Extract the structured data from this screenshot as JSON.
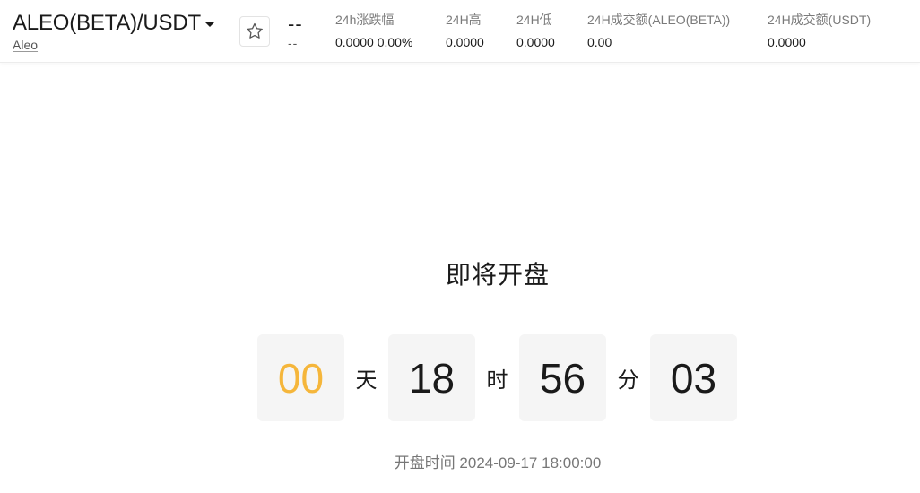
{
  "header": {
    "pair_name": "ALEO(BETA)/USDT",
    "pair_subname": "Aleo",
    "favorite_icon": "star-icon",
    "price": "--",
    "price_change": "--",
    "stats": [
      {
        "label": "24h涨跌幅",
        "value": "0.0000 0.00%"
      },
      {
        "label": "24H高",
        "value": "0.0000"
      },
      {
        "label": "24H低",
        "value": "0.0000"
      },
      {
        "label": "24H成交额(ALEO(BETA))",
        "value": "0.00"
      },
      {
        "label": "24H成交额(USDT)",
        "value": "0.0000"
      }
    ]
  },
  "main": {
    "headline": "即将开盘",
    "countdown": {
      "days": "00",
      "days_unit": "天",
      "hours": "18",
      "hours_unit": "时",
      "minutes": "56",
      "minutes_unit": "分",
      "seconds": "03"
    },
    "open_time": "开盘时间 2024-09-17 18:00:00"
  },
  "colors": {
    "countdown_highlight": "#f5b63b",
    "box_background": "#f5f5f5"
  }
}
